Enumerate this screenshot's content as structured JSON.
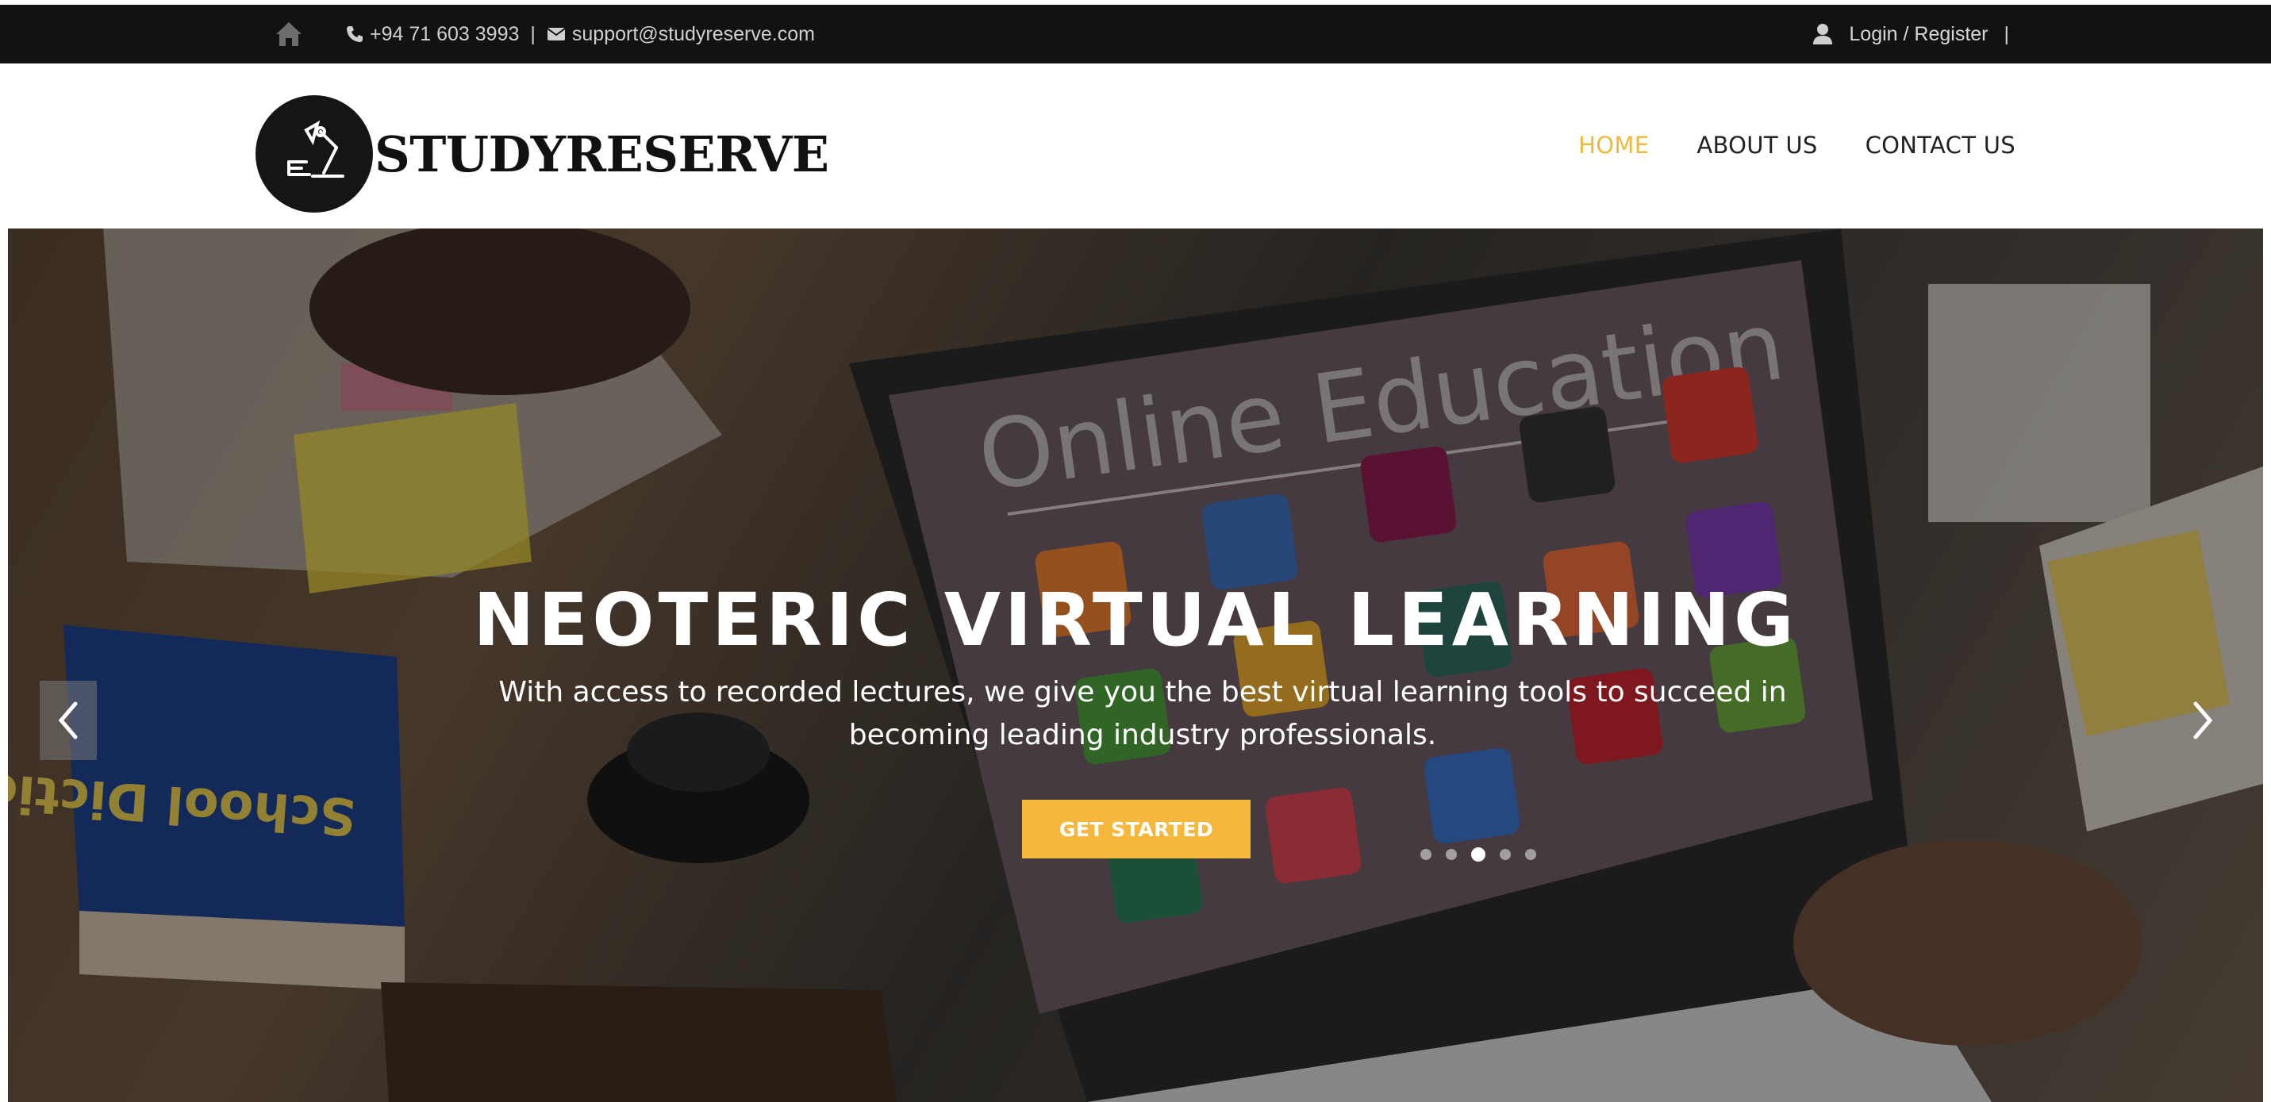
{
  "topbar": {
    "phone": "+94 71 603 3993",
    "separator": "|",
    "email": "support@studyreserve.com",
    "login": "Login / Register",
    "right_separator": "|"
  },
  "header": {
    "logo_text": "STUDYRESERVE",
    "nav": [
      {
        "label": "HOME",
        "active": true
      },
      {
        "label": "ABOUT US",
        "active": false
      },
      {
        "label": "CONTACT US",
        "active": false
      }
    ]
  },
  "hero": {
    "title": "NEOTERIC VIRTUAL LEARNING",
    "subtitle": "With access to recorded lectures, we give you the best virtual learning tools to succeed in becoming leading industry professionals.",
    "cta": "GET STARTED",
    "background_text": "Online Education",
    "book_text": "School Dictionary",
    "slide_count": 5,
    "active_slide": 3
  },
  "colors": {
    "accent": "#f5b83d",
    "nav_active": "#f0b93a",
    "topbar_bg": "#121212"
  },
  "icons": [
    "home-icon",
    "phone-icon",
    "envelope-icon",
    "user-icon",
    "chevron-left-icon",
    "chevron-right-icon",
    "desk-lamp-logo-icon"
  ]
}
